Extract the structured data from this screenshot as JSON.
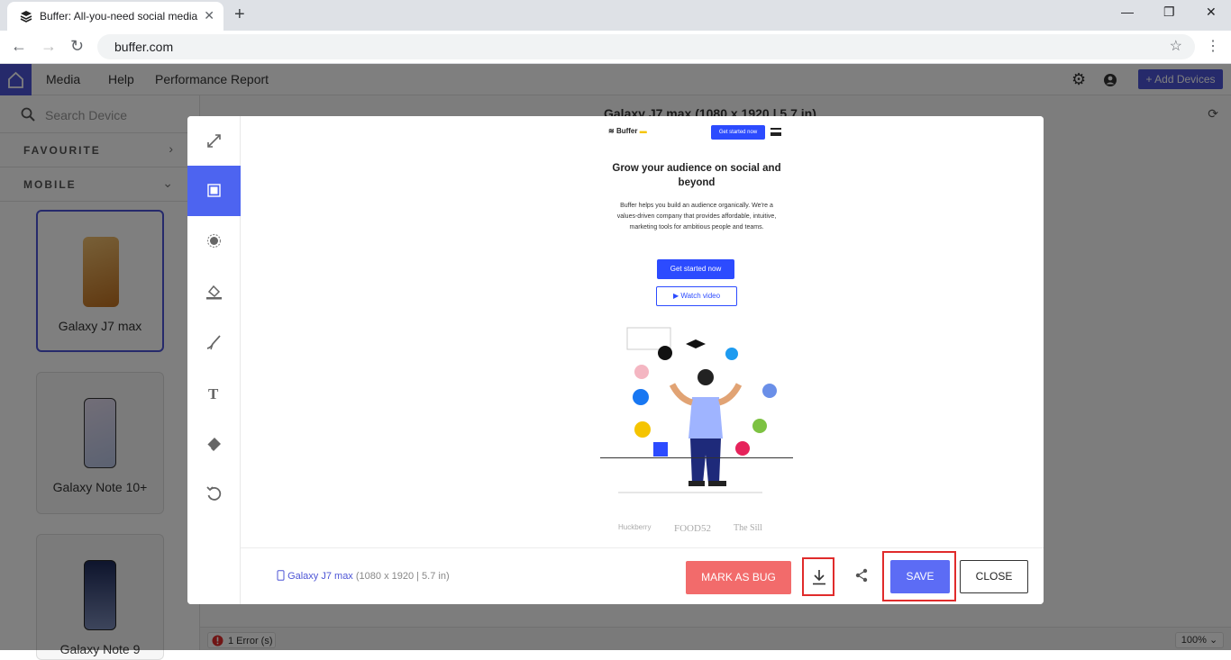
{
  "browser": {
    "tab_title": "Buffer: All-you-need social media",
    "url": "buffer.com"
  },
  "app": {
    "menu": [
      "Media",
      "Help",
      "Performance Report"
    ],
    "add_devices_label": "+ Add Devices"
  },
  "sidebar": {
    "search_placeholder": "Search Device",
    "sections": [
      "FAVOURITE",
      "MOBILE"
    ],
    "devices": [
      "Galaxy J7 max",
      "Galaxy Note 10+",
      "Galaxy Note 9"
    ]
  },
  "stage": {
    "device_heading": "Galaxy J7 max",
    "device_heading_spec": "(1080 x 1920 | 5.7 in)",
    "error_text": "1 Error (s)",
    "zoom": "100%"
  },
  "modal": {
    "device_name": "Galaxy J7 max",
    "device_spec": "(1080 x 1920 | 5.7 in)",
    "mark_as_bug_label": "MARK AS BUG",
    "save_label": "SAVE",
    "close_label": "CLOSE",
    "tools": [
      "line-tool",
      "rectangle-tool",
      "circle-tool",
      "fill-tool",
      "pen-tool",
      "text-tool",
      "eraser-tool",
      "undo-tool"
    ],
    "active_tool": "rectangle-tool"
  },
  "preview": {
    "logo": "Buffer",
    "top_cta": "Get started now",
    "headline": "Grow your audience on social and beyond",
    "body": "Buffer helps you build an audience organically. We're a values-driven company that provides affordable, intuitive, marketing tools for ambitious people and teams.",
    "primary_cta": "Get started now",
    "secondary_cta": "Watch video",
    "brand_logos": [
      "Huckberry",
      "FOOD52",
      "The Sill"
    ]
  },
  "colors": {
    "brand": "#4d55d6",
    "active_tool": "#4d64f0",
    "bug_button": "#f26b6b",
    "save_button": "#5c6cf5",
    "highlight_border": "#e02b2b"
  }
}
